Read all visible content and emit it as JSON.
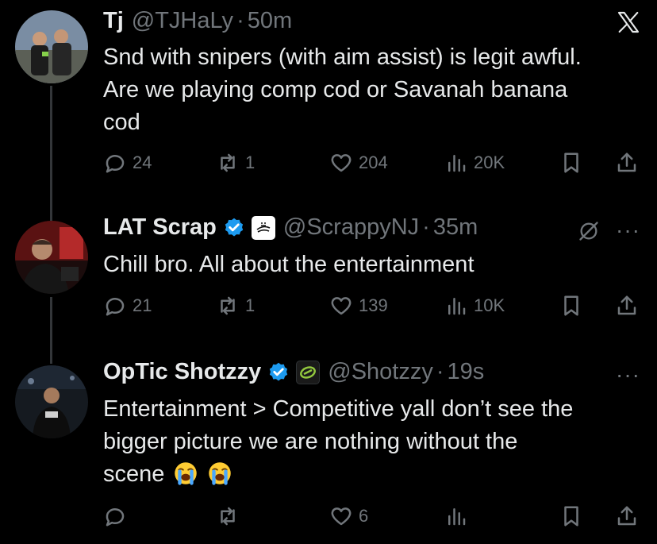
{
  "tweets": [
    {
      "name": "Tj",
      "handle": "@TJHaLy",
      "separator": "·",
      "time": "50m",
      "text_lines": [
        "Snd with snipers (with aim assist) is legit awful.",
        "Are we playing comp cod or Savanah banana",
        "cod"
      ],
      "actions": {
        "replies": "24",
        "reposts": "1",
        "likes": "204",
        "views": "20K"
      }
    },
    {
      "name": "LAT Scrap",
      "handle": "@ScrappyNJ",
      "separator": "·",
      "time": "35m",
      "text_lines": [
        "Chill bro. All about the entertainment"
      ],
      "actions": {
        "replies": "21",
        "reposts": "1",
        "likes": "139",
        "views": "10K"
      }
    },
    {
      "name": "OpTic Shotzzy",
      "handle": "@Shotzzy",
      "separator": "·",
      "time": "19s",
      "text_lines": [
        "Entertainment > Competitive yall don’t see the",
        "bigger picture we are nothing without the",
        "scene"
      ],
      "actions": {
        "replies": "",
        "reposts": "",
        "likes": "6",
        "views": ""
      }
    }
  ],
  "icons": {
    "close": "x-logo-icon",
    "grok": "grok-icon",
    "more": "more-icon",
    "reply": "reply-icon",
    "repost": "repost-icon",
    "like": "like-icon",
    "views": "views-icon",
    "bookmark": "bookmark-icon",
    "share": "share-icon",
    "verified": "verified-badge-icon",
    "emoji": "loudly-crying-face-emoji"
  },
  "more_label": "···",
  "colors": {
    "background": "#000000",
    "text": "#e7e9ea",
    "muted": "#71767b",
    "verified": "#1d9bf0",
    "optic": "#92c83e"
  }
}
